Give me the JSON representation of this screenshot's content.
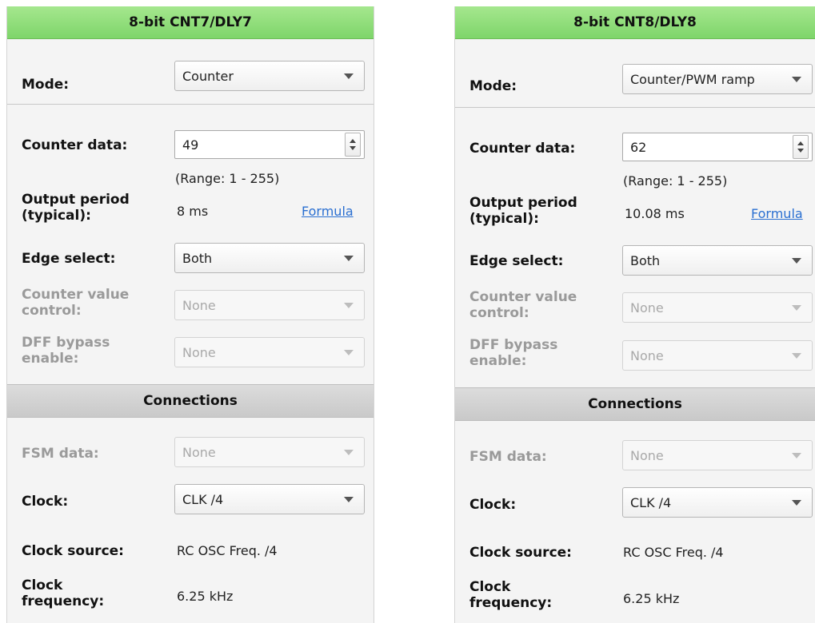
{
  "panels": [
    {
      "title": "8-bit CNT7/DLY7",
      "mode": {
        "label": "Mode:",
        "value": "Counter"
      },
      "counter_data": {
        "label": "Counter data:",
        "value": "49",
        "range": "(Range:  1 - 255)"
      },
      "output_period": {
        "label_line1": "Output period",
        "label_line2": "(typical):",
        "value": "8 ms",
        "link": "Formula"
      },
      "edge_select": {
        "label": "Edge select:",
        "value": "Both"
      },
      "counter_value_control": {
        "label_line1": "Counter value",
        "label_line2": "control:",
        "value": "None"
      },
      "dff_bypass": {
        "label_line1": "DFF bypass",
        "label_line2": "enable:",
        "value": "None"
      },
      "connections": "Connections",
      "fsm_data": {
        "label": "FSM data:",
        "value": "None"
      },
      "clock": {
        "label": "Clock:",
        "value": "CLK /4"
      },
      "clock_source": {
        "label": "Clock source:",
        "value": "RC OSC Freq. /4"
      },
      "clock_frequency": {
        "label_line1": "Clock",
        "label_line2": "frequency:",
        "value": "6.25 kHz"
      }
    },
    {
      "title": "8-bit CNT8/DLY8",
      "mode": {
        "label": "Mode:",
        "value": "Counter/PWM ramp"
      },
      "counter_data": {
        "label": "Counter data:",
        "value": "62",
        "range": "(Range:  1 - 255)"
      },
      "output_period": {
        "label_line1": "Output period",
        "label_line2": "(typical):",
        "value": "10.08 ms",
        "link": "Formula"
      },
      "edge_select": {
        "label": "Edge select:",
        "value": "Both"
      },
      "counter_value_control": {
        "label_line1": "Counter value",
        "label_line2": "control:",
        "value": "None"
      },
      "dff_bypass": {
        "label_line1": "DFF bypass",
        "label_line2": "enable:",
        "value": "None"
      },
      "connections": "Connections",
      "fsm_data": {
        "label": "FSM data:",
        "value": "None"
      },
      "clock": {
        "label": "Clock:",
        "value": "CLK /4"
      },
      "clock_source": {
        "label": "Clock source:",
        "value": "RC OSC Freq. /4"
      },
      "clock_frequency": {
        "label_line1": "Clock",
        "label_line2": "frequency:",
        "value": "6.25 kHz"
      }
    }
  ],
  "colors": {
    "header_green": "#7ed56a",
    "link_blue": "#2a6fd1",
    "disabled_text": "#9a9a9a"
  }
}
